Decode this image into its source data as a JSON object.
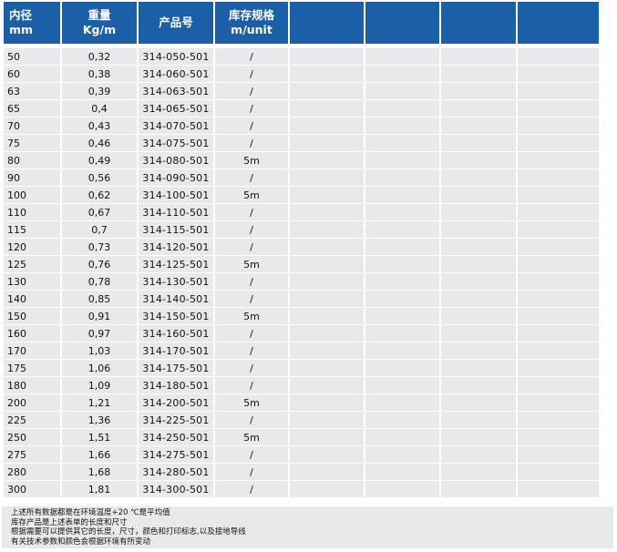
{
  "headers": [
    {
      "line1": "内径",
      "line2": "mm"
    },
    {
      "line1": "重量",
      "line2": "Kg/m"
    },
    {
      "line1": "产品号",
      "line2": ""
    },
    {
      "line1": "库存规格",
      "line2": "m/unit"
    },
    {
      "line1": "",
      "line2": ""
    },
    {
      "line1": "",
      "line2": ""
    },
    {
      "line1": "",
      "line2": ""
    },
    {
      "line1": "",
      "line2": ""
    }
  ],
  "rows": [
    [
      "50",
      "0,32",
      "314-050-501",
      "/"
    ],
    [
      "60",
      "0,38",
      "314-060-501",
      "/"
    ],
    [
      "63",
      "0,39",
      "314-063-501",
      "/"
    ],
    [
      "65",
      "0,4",
      "314-065-501",
      "/"
    ],
    [
      "70",
      "0,43",
      "314-070-501",
      "/"
    ],
    [
      "75",
      "0,46",
      "314-075-501",
      "/"
    ],
    [
      "80",
      "0,49",
      "314-080-501",
      "5m"
    ],
    [
      "90",
      "0,56",
      "314-090-501",
      "/"
    ],
    [
      "100",
      "0,62",
      "314-100-501",
      "5m"
    ],
    [
      "110",
      "0,67",
      "314-110-501",
      "/"
    ],
    [
      "115",
      "0,7",
      "314-115-501",
      "/"
    ],
    [
      "120",
      "0,73",
      "314-120-501",
      "/"
    ],
    [
      "125",
      "0,76",
      "314-125-501",
      "5m"
    ],
    [
      "130",
      "0,78",
      "314-130-501",
      "/"
    ],
    [
      "140",
      "0,85",
      "314-140-501",
      "/"
    ],
    [
      "150",
      "0,91",
      "314-150-501",
      "5m"
    ],
    [
      "160",
      "0,97",
      "314-160-501",
      "/"
    ],
    [
      "170",
      "1,03",
      "314-170-501",
      "/"
    ],
    [
      "175",
      "1,06",
      "314-175-501",
      "/"
    ],
    [
      "180",
      "1,09",
      "314-180-501",
      "/"
    ],
    [
      "200",
      "1,21",
      "314-200-501",
      "5m"
    ],
    [
      "225",
      "1,36",
      "314-225-501",
      "/"
    ],
    [
      "250",
      "1,51",
      "314-250-501",
      "5m"
    ],
    [
      "275",
      "1,66",
      "314-275-501",
      "/"
    ],
    [
      "280",
      "1,68",
      "314-280-501",
      "/"
    ],
    [
      "300",
      "1,81",
      "314-300-501",
      "/"
    ]
  ],
  "notes": [
    "上述所有数据都是在环境温度+20 ℃是平均值",
    "库存产品是上述表单的长度和尺寸",
    "根据需要可以提供其它的长度，尺寸，颜色和打印标志,以及接地导线",
    "有关技术参数和颜色会根据环境有所变动"
  ],
  "colors": {
    "header_bg": "#1a5fa8",
    "header_text": "#ffffff",
    "cell_bg": "#e8e9ea"
  }
}
